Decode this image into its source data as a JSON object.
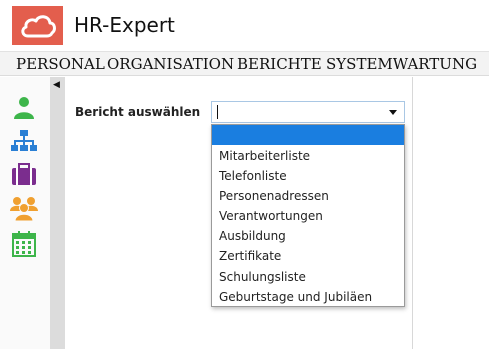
{
  "app": {
    "title": "HR-Expert",
    "brand_color": "#e35e4d"
  },
  "menu": {
    "items": [
      {
        "label": "Personal"
      },
      {
        "label": "Organisation"
      },
      {
        "label": "Berichte"
      },
      {
        "label": "Systemwartung"
      }
    ]
  },
  "sidebar": {
    "icons": [
      {
        "name": "person-icon",
        "color": "#3db54a"
      },
      {
        "name": "org-chart-icon",
        "color": "#2a7fd4"
      },
      {
        "name": "briefcase-icon",
        "color": "#7b2d8e"
      },
      {
        "name": "group-icon",
        "color": "#f0a030"
      },
      {
        "name": "calendar-icon",
        "color": "#3db54a"
      }
    ]
  },
  "form": {
    "label": "Bericht auswählen",
    "selected_value": ""
  },
  "dropdown": {
    "options": [
      "Mitarbeiterliste",
      "Telefonliste",
      "Personenadressen",
      "Verantwortungen",
      "Ausbildung",
      "Zertifikate",
      "Schulungsliste",
      "Geburtstage und Jubiläen"
    ],
    "highlight_color": "#1a7ee0"
  }
}
